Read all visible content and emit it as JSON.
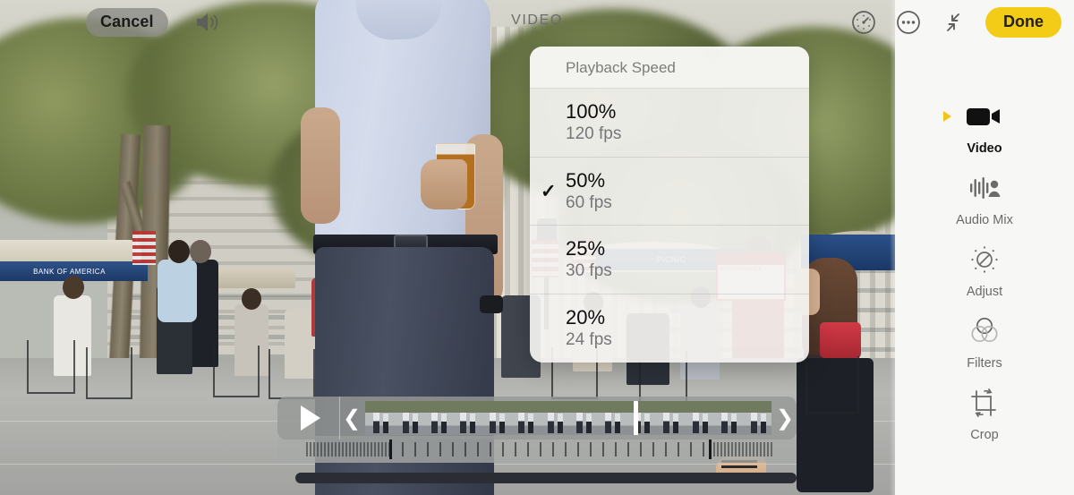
{
  "topbar": {
    "cancel_label": "Cancel",
    "speaker_icon": "speaker-wave-icon",
    "title": "VIDEO",
    "speed_icon": "speedometer-icon",
    "more_icon": "more-options-icon",
    "collapse_icon": "collapse-arrows-icon",
    "done_label": "Done",
    "done_color": "#f3cc18"
  },
  "popup": {
    "header": "Playback Speed",
    "options": [
      {
        "percent": "100%",
        "fps": "120 fps",
        "selected": false,
        "check": ""
      },
      {
        "percent": "50%",
        "fps": "60 fps",
        "selected": true,
        "check": "✓"
      },
      {
        "percent": "25%",
        "fps": "30 fps",
        "selected": false,
        "check": ""
      },
      {
        "percent": "20%",
        "fps": "24 fps",
        "selected": false,
        "check": ""
      }
    ]
  },
  "sidebar": {
    "tools": [
      {
        "label": "Video",
        "icon": "video-camera-icon",
        "active": true
      },
      {
        "label": "Audio Mix",
        "icon": "audio-mix-icon",
        "active": false
      },
      {
        "label": "Adjust",
        "icon": "adjust-dial-icon",
        "active": false
      },
      {
        "label": "Filters",
        "icon": "filters-circles-icon",
        "active": false
      },
      {
        "label": "Crop",
        "icon": "crop-rotate-icon",
        "active": false
      }
    ],
    "active_marker_color": "#f0c419"
  },
  "timeline": {
    "play_icon": "play-triangle-icon",
    "trim_left_icon": "chevron-left-icon",
    "trim_left_glyph": "❮",
    "trim_right_icon": "chevron-right-icon",
    "trim_right_glyph": "❯",
    "playhead_position_percent": 66,
    "frame_count": 14
  },
  "scene": {
    "umbrella_bank_text": "BANK OF AMERICA",
    "umbrella_picnic_text": "PICNIC",
    "sign_text": "PERFORMANCE"
  }
}
